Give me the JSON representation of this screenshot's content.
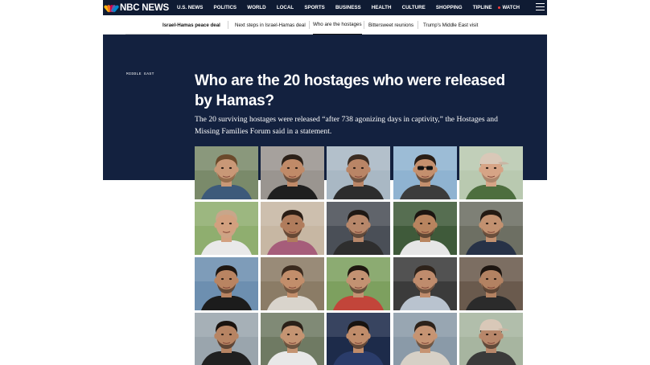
{
  "brand": {
    "name": "NBC NEWS"
  },
  "nav": {
    "links": [
      "U.S. NEWS",
      "POLITICS",
      "WORLD",
      "LOCAL",
      "SPORTS",
      "BUSINESS",
      "HEALTH",
      "CULTURE",
      "SHOPPING",
      "TIPLINE"
    ],
    "watch_label": "WATCH"
  },
  "subnav": {
    "title": "Israel-Hamas peace deal",
    "links": [
      "Next steps in Israel-Hamas deal",
      "Who are the hostages",
      "Bittersweet reunions",
      "Trump's Middle East visit"
    ],
    "active_index": 1
  },
  "article": {
    "section": "MIDDLE EAST",
    "headline_line1": "Who are the 20 hostages who were released",
    "headline_line2": "by Hamas?",
    "dek_line1": "The 20 surviving hostages were released “after 738 agonizing days in captivity,” the Hostages and",
    "dek_line2": "Missing Families Forum said in a statement."
  },
  "photos": [
    {
      "skin": "#c99877",
      "hair": "#6b4a2b",
      "bg": "#7a8a6a",
      "shirt": "#3d5a7a",
      "accessory": "none"
    },
    {
      "skin": "#c08a68",
      "hair": "#2b2018",
      "bg": "#9a9590",
      "shirt": "#1f1f1f",
      "accessory": "none"
    },
    {
      "skin": "#b98566",
      "hair": "#3a2c22",
      "bg": "#a9b8c4",
      "shirt": "#2d2d2d",
      "accessory": "none"
    },
    {
      "skin": "#c4906e",
      "hair": "#2a1e16",
      "bg": "#8fb3d1",
      "shirt": "#3c3c3c",
      "accessory": "sunglasses"
    },
    {
      "skin": "#d6a486",
      "hair": "#8a6b55",
      "bg": "#b9c9b0",
      "shirt": "#4d6e3e",
      "accessory": "cap"
    },
    {
      "skin": "#d2a07f",
      "hair": "#c8a68a",
      "bg": "#8fae6f",
      "shirt": "#e9e9e9",
      "accessory": "none"
    },
    {
      "skin": "#b07c5c",
      "hair": "#2a1d15",
      "bg": "#c7b7a3",
      "shirt": "#a65d7a",
      "accessory": "none"
    },
    {
      "skin": "#b7876a",
      "hair": "#1e1814",
      "bg": "#4a4f57",
      "shirt": "#2e2e2e",
      "accessory": "none"
    },
    {
      "skin": "#b8845f",
      "hair": "#1c1511",
      "bg": "#3f5a3a",
      "shirt": "#e6e6e6",
      "accessory": "none"
    },
    {
      "skin": "#c29170",
      "hair": "#241a13",
      "bg": "#6d6f63",
      "shirt": "#273247",
      "accessory": "none"
    },
    {
      "skin": "#b98462",
      "hair": "#1f1712",
      "bg": "#6d8fb0",
      "shirt": "#1c1c1c",
      "accessory": "none"
    },
    {
      "skin": "#c28e6b",
      "hair": "#3a2a1e",
      "bg": "#8b7c66",
      "shirt": "#d9d4cc",
      "accessory": "none"
    },
    {
      "skin": "#c39272",
      "hair": "#1f1710",
      "bg": "#7da05f",
      "shirt": "#c2453a",
      "accessory": "none"
    },
    {
      "skin": "#bf8c6d",
      "hair": "#2e231b",
      "bg": "#3b3b3b",
      "shirt": "#b9c3cf",
      "accessory": "none"
    },
    {
      "skin": "#b38262",
      "hair": "#1d1510",
      "bg": "#6a5a4d",
      "shirt": "#2b2b2b",
      "accessory": "none"
    },
    {
      "skin": "#b78463",
      "hair": "#1a130f",
      "bg": "#9aa5ad",
      "shirt": "#202020",
      "accessory": "none"
    },
    {
      "skin": "#c49472",
      "hair": "#2a2018",
      "bg": "#6f7a63",
      "shirt": "#e8e8e8",
      "accessory": "none"
    },
    {
      "skin": "#c08c6a",
      "hair": "#181310",
      "bg": "#1d2b4a",
      "shirt": "#2a3c6a",
      "accessory": "none"
    },
    {
      "skin": "#c69473",
      "hair": "#2d221a",
      "bg": "#8a9aa8",
      "shirt": "#d6d0c6",
      "accessory": "none"
    },
    {
      "skin": "#b8876a",
      "hair": "#1b1511",
      "bg": "#a7b5a0",
      "shirt": "#3a3a3a",
      "accessory": "cap"
    }
  ]
}
